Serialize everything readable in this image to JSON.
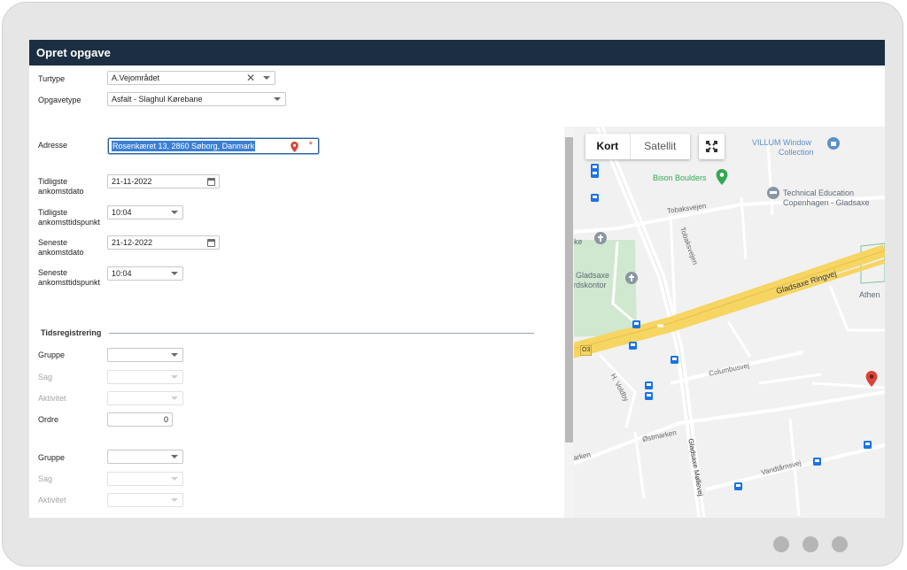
{
  "window": {
    "title": "Opret opgave"
  },
  "form": {
    "turtype": {
      "label": "Turtype",
      "value": "A.Vejområdet"
    },
    "opgavetype": {
      "label": "Opgavetype",
      "value": "Asfalt - Slaghul Kørebane"
    },
    "adresse": {
      "label": "Adresse",
      "value": "Rosenkæret 13, 2860 Søborg, Danmark",
      "required_mark": "*"
    },
    "tidligste_dato": {
      "label_line1": "Tidligste",
      "label_line2": "ankomstdato",
      "value": "21-11-2022"
    },
    "tidligste_tid": {
      "label_line1": "Tidligste",
      "label_line2": "ankomsttidspunkt",
      "value": "10:04"
    },
    "seneste_dato": {
      "label_line1": "Seneste",
      "label_line2": "ankomstdato",
      "value": "21-12-2022"
    },
    "seneste_tid": {
      "label_line1": "Seneste",
      "label_line2": "ankomsttidspunkt",
      "value": "10:04"
    }
  },
  "tidsregistrering": {
    "title": "Tidsregistrering",
    "group1": {
      "gruppe_label": "Gruppe",
      "sag_label": "Sag",
      "aktivitet_label": "Aktivitet",
      "ordre_label": "Ordre",
      "ordre_value": "0"
    },
    "group2": {
      "gruppe_label": "Gruppe",
      "sag_label": "Sag",
      "aktivitet_label": "Aktivitet"
    }
  },
  "map": {
    "type_options": [
      "Kort",
      "Satellit"
    ],
    "selected_type": "Kort",
    "labels": {
      "villum": "VILLUM Window",
      "villum2": "Collection",
      "bison": "Bison Boulders",
      "tech1": "Technical Education",
      "tech2": "Copenhagen - Gladsaxe",
      "tobaksvejen": "Tobaksvejen",
      "tobaksvejen_v": "Tobaksvejen",
      "kirke": "Kirke",
      "gladsaxe1": "Gladsaxe",
      "gladsaxe2": "gårdskontor",
      "ringvej": "Gladsaxe Ringvej",
      "athen": "Athen",
      "o3": "O3",
      "columbusvej": "Columbusvej",
      "voldby": "H. Voldby",
      "ostmarken": "Østmarken",
      "marken": "arken",
      "mollevej": "Gladsaxe Møllevej",
      "vandtarnsvej": "Vandtårnsvej"
    },
    "colors": {
      "road_major": "#f6d562",
      "park": "#cfe8cf",
      "pin": "#d9443a",
      "poi_green": "#34a853",
      "poi_blue": "#5b8fc7",
      "bus": "#1a73e8"
    }
  },
  "pager": {
    "dots": 3
  }
}
